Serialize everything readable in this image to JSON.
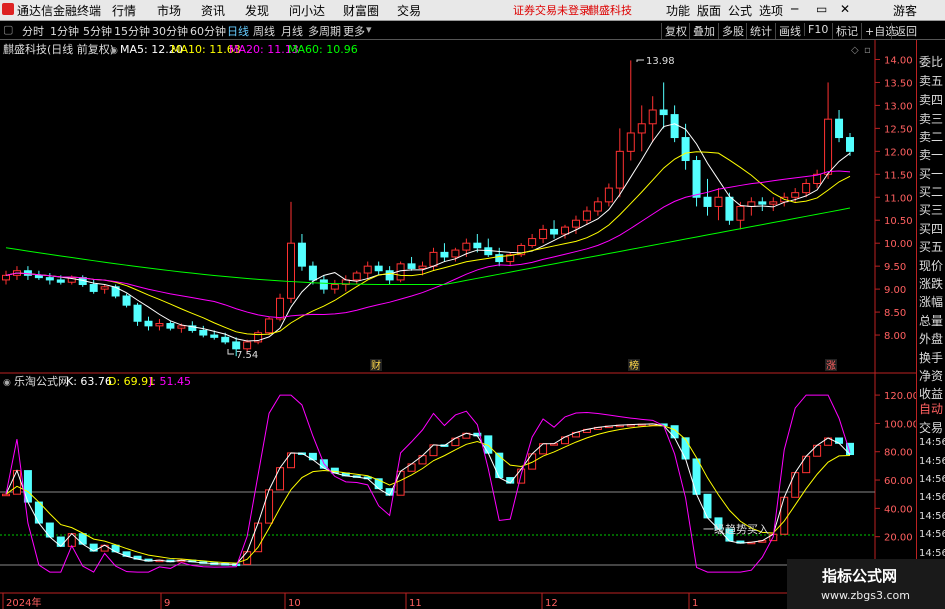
{
  "menubar": {
    "app_name": "通达信金融终端",
    "items": [
      "行情",
      "市场",
      "资讯",
      "发现",
      "问小达",
      "财富圈",
      "交易"
    ],
    "login_warning": "证券交易未登录",
    "stock_name": "麒盛科技",
    "right_items": [
      "功能",
      "版面",
      "公式",
      "选项"
    ],
    "user": "游客"
  },
  "periodbar": {
    "periods": [
      "分时",
      "1分钟",
      "5分钟",
      "15分钟",
      "30分钟",
      "60分钟",
      "日线",
      "周线",
      "月线",
      "多周期",
      "更多"
    ],
    "selected": "日线",
    "right_buttons": [
      "复权",
      "叠加",
      "多股",
      "统计",
      "画线",
      "F10",
      "标记",
      "+自选",
      "返回"
    ]
  },
  "main_panel": {
    "title": "麒盛科技(日线 前复权)",
    "ma5": "MA5: 12.20",
    "ma10": "MA10: 11.63",
    "ma20": "MA20: 11.13",
    "ma60": "MA60: 10.96",
    "high_label": "13.98",
    "low_label": "7.54",
    "markers": [
      "财",
      "榜",
      "涨"
    ],
    "price_ticks": [
      "14.00",
      "13.50",
      "13.00",
      "12.50",
      "12.00",
      "11.50",
      "11.00",
      "10.50",
      "10.00",
      "9.50",
      "9.00",
      "8.50",
      "8.00"
    ]
  },
  "sub_panel": {
    "title": "乐淘公式网",
    "k": "K: 63.76",
    "d": "D: 69.91",
    "j": "J: 51.45",
    "ticks": [
      "120.00",
      "100.00",
      "80.00",
      "60.00",
      "40.00",
      "20.00"
    ],
    "annotation": "一级趋势买入"
  },
  "time_axis": [
    "2024年",
    "9",
    "10",
    "11",
    "12",
    "1"
  ],
  "right_panel": {
    "labels": [
      "委比",
      "卖五",
      "卖四",
      "卖三",
      "卖二",
      "卖一",
      "买一",
      "买二",
      "买三",
      "买四",
      "买五",
      "现价",
      "涨跌",
      "涨幅",
      "总量",
      "外盘",
      "换手",
      "净资",
      "收益",
      "自动",
      "交易",
      "14:56",
      "14:56",
      "14:56",
      "14:56",
      "14:56",
      "14:56",
      "14:56",
      "14:56",
      "14:56"
    ]
  },
  "watermark": {
    "title": "指标公式网",
    "url": "www.zbgs3.com"
  },
  "colors": {
    "up": "#ff3232",
    "down": "#54ffff",
    "ma5": "#ffffff",
    "ma10": "#ffff00",
    "ma20": "#ff00ff",
    "ma60": "#00ff00"
  },
  "chart_data": {
    "type": "candlestick",
    "note_series": "daily price approximations",
    "price_range": [
      7.5,
      14.0
    ],
    "ohlc": [
      [
        9.2,
        9.4,
        9.1,
        9.3
      ],
      [
        9.3,
        9.5,
        9.2,
        9.4
      ],
      [
        9.4,
        9.5,
        9.2,
        9.3
      ],
      [
        9.3,
        9.4,
        9.2,
        9.25
      ],
      [
        9.25,
        9.35,
        9.1,
        9.2
      ],
      [
        9.2,
        9.3,
        9.1,
        9.15
      ],
      [
        9.15,
        9.3,
        9.1,
        9.25
      ],
      [
        9.25,
        9.3,
        9.05,
        9.1
      ],
      [
        9.1,
        9.2,
        8.9,
        8.95
      ],
      [
        9.0,
        9.1,
        8.9,
        9.05
      ],
      [
        9.05,
        9.1,
        8.8,
        8.85
      ],
      [
        8.85,
        8.9,
        8.6,
        8.65
      ],
      [
        8.65,
        8.7,
        8.2,
        8.3
      ],
      [
        8.3,
        8.4,
        8.1,
        8.2
      ],
      [
        8.2,
        8.35,
        8.1,
        8.25
      ],
      [
        8.25,
        8.3,
        8.1,
        8.15
      ],
      [
        8.15,
        8.25,
        8.05,
        8.2
      ],
      [
        8.2,
        8.3,
        8.05,
        8.1
      ],
      [
        8.1,
        8.2,
        7.95,
        8.0
      ],
      [
        8.0,
        8.1,
        7.9,
        7.95
      ],
      [
        7.95,
        8.05,
        7.8,
        7.85
      ],
      [
        7.85,
        7.95,
        7.54,
        7.7
      ],
      [
        7.7,
        7.9,
        7.6,
        7.85
      ],
      [
        7.85,
        8.1,
        7.8,
        8.05
      ],
      [
        8.05,
        8.4,
        8.0,
        8.35
      ],
      [
        8.35,
        8.9,
        8.3,
        8.8
      ],
      [
        8.8,
        10.9,
        8.7,
        10.0
      ],
      [
        10.0,
        10.2,
        9.4,
        9.5
      ],
      [
        9.5,
        9.6,
        9.1,
        9.2
      ],
      [
        9.2,
        9.3,
        8.9,
        9.0
      ],
      [
        9.0,
        9.2,
        8.9,
        9.1
      ],
      [
        9.1,
        9.3,
        8.95,
        9.2
      ],
      [
        9.2,
        9.4,
        9.1,
        9.35
      ],
      [
        9.35,
        9.6,
        9.2,
        9.5
      ],
      [
        9.5,
        9.6,
        9.3,
        9.4
      ],
      [
        9.4,
        9.5,
        9.1,
        9.2
      ],
      [
        9.2,
        9.6,
        9.15,
        9.55
      ],
      [
        9.55,
        9.7,
        9.4,
        9.45
      ],
      [
        9.45,
        9.6,
        9.3,
        9.5
      ],
      [
        9.5,
        9.9,
        9.4,
        9.8
      ],
      [
        9.8,
        10.0,
        9.6,
        9.7
      ],
      [
        9.7,
        9.9,
        9.6,
        9.85
      ],
      [
        9.85,
        10.1,
        9.7,
        10.0
      ],
      [
        10.0,
        10.2,
        9.8,
        9.9
      ],
      [
        9.9,
        10.1,
        9.7,
        9.75
      ],
      [
        9.75,
        9.9,
        9.5,
        9.6
      ],
      [
        9.6,
        9.8,
        9.5,
        9.75
      ],
      [
        9.75,
        10.0,
        9.7,
        9.95
      ],
      [
        9.95,
        10.2,
        9.9,
        10.1
      ],
      [
        10.1,
        10.4,
        10.0,
        10.3
      ],
      [
        10.3,
        10.5,
        10.1,
        10.2
      ],
      [
        10.2,
        10.4,
        10.1,
        10.35
      ],
      [
        10.35,
        10.6,
        10.2,
        10.5
      ],
      [
        10.5,
        10.8,
        10.4,
        10.7
      ],
      [
        10.7,
        11.0,
        10.6,
        10.9
      ],
      [
        10.9,
        11.3,
        10.8,
        11.2
      ],
      [
        11.2,
        12.5,
        11.0,
        12.0
      ],
      [
        12.0,
        13.98,
        11.8,
        12.4
      ],
      [
        12.4,
        13.0,
        12.0,
        12.6
      ],
      [
        12.6,
        13.2,
        12.2,
        12.9
      ],
      [
        12.9,
        13.5,
        12.5,
        12.8
      ],
      [
        12.8,
        13.0,
        12.2,
        12.3
      ],
      [
        12.3,
        12.6,
        11.6,
        11.8
      ],
      [
        11.8,
        11.9,
        10.8,
        11.0
      ],
      [
        11.0,
        11.4,
        10.6,
        10.8
      ],
      [
        10.8,
        11.2,
        10.5,
        11.0
      ],
      [
        11.0,
        11.1,
        10.4,
        10.5
      ],
      [
        10.5,
        10.9,
        10.3,
        10.8
      ],
      [
        10.8,
        11.0,
        10.6,
        10.9
      ],
      [
        10.9,
        11.0,
        10.7,
        10.85
      ],
      [
        10.85,
        11.0,
        10.7,
        10.9
      ],
      [
        10.9,
        11.1,
        10.8,
        11.0
      ],
      [
        11.0,
        11.2,
        10.9,
        11.1
      ],
      [
        11.1,
        11.4,
        11.0,
        11.3
      ],
      [
        11.3,
        11.6,
        11.2,
        11.5
      ],
      [
        11.5,
        13.5,
        11.4,
        12.7
      ],
      [
        12.7,
        12.9,
        12.2,
        12.3
      ],
      [
        12.3,
        12.4,
        11.9,
        12.0
      ]
    ]
  }
}
